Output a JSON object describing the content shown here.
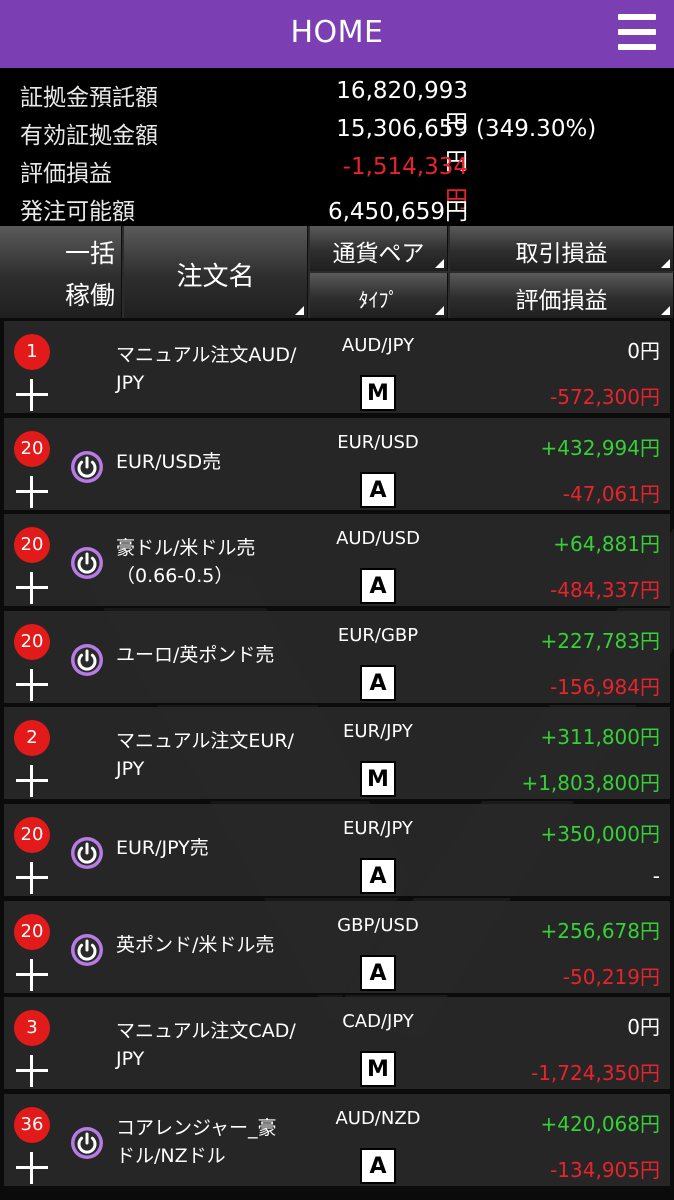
{
  "header": {
    "title": "HOME",
    "menu_icon": "hamburger-menu-icon"
  },
  "summary": [
    {
      "label": "証拠金預託額",
      "value": "16,820,993円",
      "extra": "",
      "negative": false
    },
    {
      "label": "有効証拠金額",
      "value": "15,306,659円",
      "extra": "(349.30%)",
      "negative": false
    },
    {
      "label": "評価損益",
      "value": "-1,514,334円",
      "extra": "",
      "negative": true
    },
    {
      "label": "発注可能額",
      "value": "6,450,659円",
      "extra": "",
      "negative": false
    }
  ],
  "columns": {
    "bulk_line1": "一括",
    "bulk_line2": "稼働",
    "order_name": "注文名",
    "currency_pair": "通貨ペア",
    "type": "ﾀｲﾌﾟ",
    "trade_pnl": "取引損益",
    "eval_pnl": "評価損益"
  },
  "colors": {
    "header_purple": "#7c3fb3",
    "positive": "#36d136",
    "negative": "#e8232b",
    "badge_red": "#e21a1a",
    "power_purple": "#b77ae6"
  },
  "orders": [
    {
      "count": "1",
      "power": false,
      "name": "マニュアル注文AUD/JPY",
      "name_lines": [
        "マニュアル注文AUD/",
        "JPY"
      ],
      "pair": "AUD/JPY",
      "type": "M",
      "pnl": "0円",
      "pnl_sign": "neu",
      "eval": "-572,300円",
      "eval_sign": "neg"
    },
    {
      "count": "20",
      "power": true,
      "name": "EUR/USD売",
      "name_lines": [
        "EUR/USD売"
      ],
      "pair": "EUR/USD",
      "type": "A",
      "pnl": "+432,994円",
      "pnl_sign": "pos",
      "eval": "-47,061円",
      "eval_sign": "neg"
    },
    {
      "count": "20",
      "power": true,
      "name": "豪ドル/米ドル売（0.66-0.5）",
      "name_lines": [
        "豪ドル/米ドル売",
        "（0.66-0.5）"
      ],
      "pair": "AUD/USD",
      "type": "A",
      "pnl": "+64,881円",
      "pnl_sign": "pos",
      "eval": "-484,337円",
      "eval_sign": "neg"
    },
    {
      "count": "20",
      "power": true,
      "name": "ユーロ/英ポンド売",
      "name_lines": [
        "ユーロ/英ポンド売"
      ],
      "pair": "EUR/GBP",
      "type": "A",
      "pnl": "+227,783円",
      "pnl_sign": "pos",
      "eval": "-156,984円",
      "eval_sign": "neg"
    },
    {
      "count": "2",
      "power": false,
      "name": "マニュアル注文EUR/JPY",
      "name_lines": [
        "マニュアル注文EUR/",
        "JPY"
      ],
      "pair": "EUR/JPY",
      "type": "M",
      "pnl": "+311,800円",
      "pnl_sign": "pos",
      "eval": "+1,803,800円",
      "eval_sign": "pos"
    },
    {
      "count": "20",
      "power": true,
      "name": "EUR/JPY売",
      "name_lines": [
        "EUR/JPY売"
      ],
      "pair": "EUR/JPY",
      "type": "A",
      "pnl": "+350,000円",
      "pnl_sign": "pos",
      "eval": "-",
      "eval_sign": "neu"
    },
    {
      "count": "20",
      "power": true,
      "name": "英ポンド/米ドル売",
      "name_lines": [
        "英ポンド/米ドル売"
      ],
      "pair": "GBP/USD",
      "type": "A",
      "pnl": "+256,678円",
      "pnl_sign": "pos",
      "eval": "-50,219円",
      "eval_sign": "neg"
    },
    {
      "count": "3",
      "power": false,
      "name": "マニュアル注文CAD/JPY",
      "name_lines": [
        "マニュアル注文CAD/",
        "JPY"
      ],
      "pair": "CAD/JPY",
      "type": "M",
      "pnl": "0円",
      "pnl_sign": "neu",
      "eval": "-1,724,350円",
      "eval_sign": "neg"
    },
    {
      "count": "36",
      "power": true,
      "name": "コアレンジャー_豪ドル/NZドル",
      "name_lines": [
        "コアレンジャー_豪",
        "ドル/NZドル"
      ],
      "pair": "AUD/NZD",
      "type": "A",
      "pnl": "+420,068円",
      "pnl_sign": "pos",
      "eval": "-134,905円",
      "eval_sign": "neg"
    }
  ]
}
